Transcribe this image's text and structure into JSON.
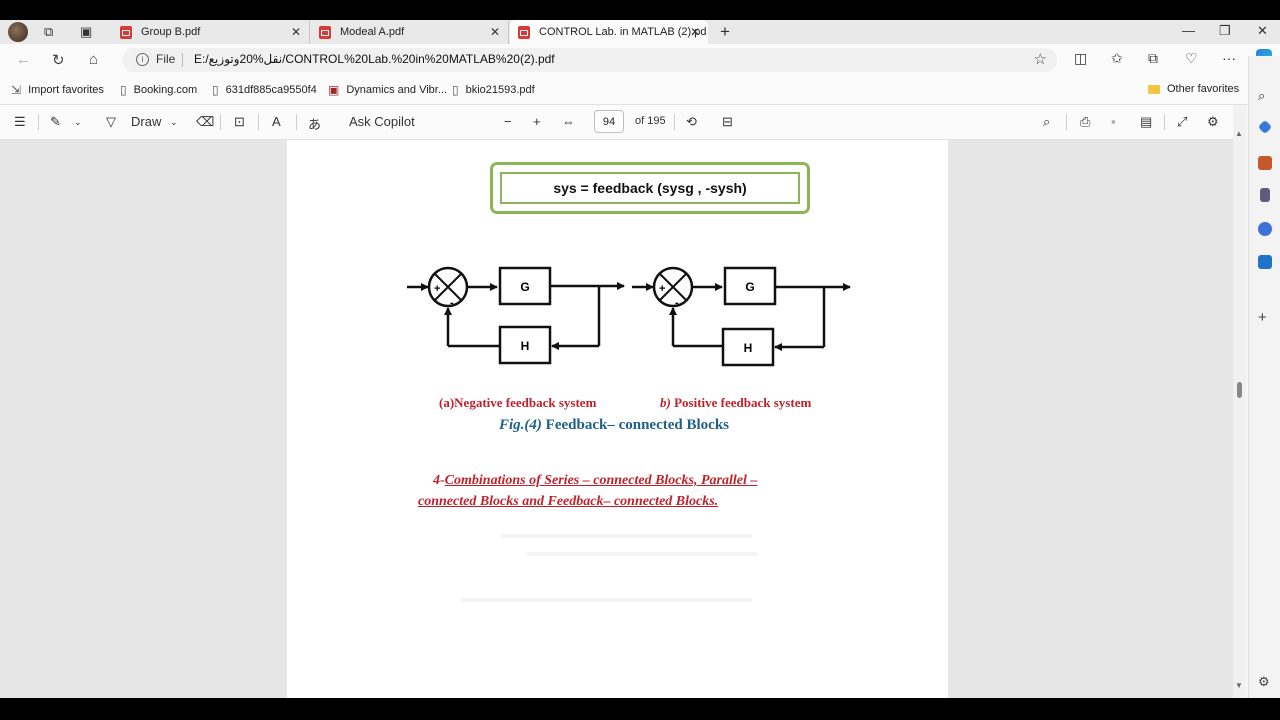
{
  "browser": {
    "tabs": [
      {
        "label": "Group B.pdf"
      },
      {
        "label": "Modeal A.pdf"
      },
      {
        "label": "CONTROL Lab. in MATLAB (2).pd"
      }
    ],
    "address": {
      "scheme_label": "File",
      "url": "E:/نقل%20وتوزيع/CONTROL%20Lab.%20in%20MATLAB%20(2).pdf"
    },
    "favorites": [
      {
        "label": "Import favorites"
      },
      {
        "label": "Booking.com"
      },
      {
        "label": "631df885ca9550f4"
      },
      {
        "label": "Dynamics and Vibr..."
      },
      {
        "label": "bkio21593.pdf"
      }
    ],
    "other_favorites": "Other favorites"
  },
  "pdf_toolbar": {
    "draw_label": "Draw",
    "ask_copilot": "Ask Copilot",
    "page_number": "94",
    "page_total": "of 195"
  },
  "page": {
    "code": "sys = feedback (sysg , -sysh)",
    "block_labels": {
      "g": "G",
      "h": "H",
      "plus": "+",
      "minus": "-"
    },
    "caption_a": "(a)Negative feedback system",
    "caption_b_prefix": "b)",
    "caption_b": " Positive  feedback system",
    "fig_prefix": "Fig.(4)",
    "fig_caption": " Feedback– connected Blocks",
    "heading_number": "4-",
    "heading_text": "Combinations of Series – connected Blocks, Parallel – connected Blocks and Feedback– connected Blocks."
  }
}
